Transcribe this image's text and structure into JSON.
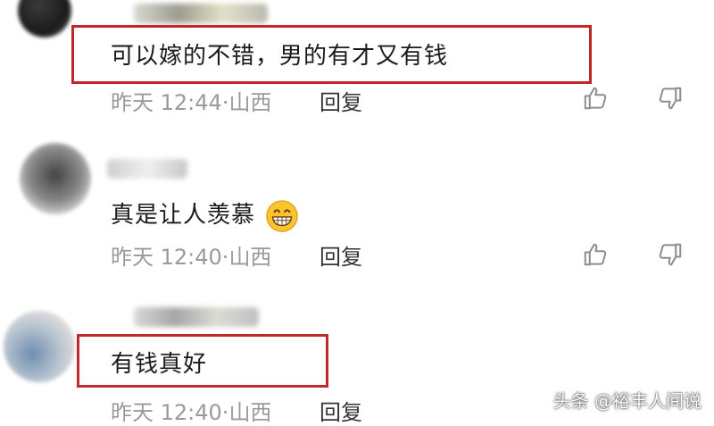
{
  "comments": [
    {
      "text": "可以嫁的不错，男的有才又有钱",
      "time": "昨天 12:44",
      "location": "山西",
      "reply_label": "回复"
    },
    {
      "text": "真是让人羡慕",
      "emoji": "grinning-face",
      "time": "昨天 12:40",
      "location": "山西",
      "reply_label": "回复"
    },
    {
      "text": "有钱真好",
      "time": "昨天 12:40",
      "location": "山西",
      "reply_label": "回复"
    }
  ],
  "meta_separator": "·",
  "watermark": "头条 @裕丰人间说",
  "colors": {
    "highlight_border": "#c0282c",
    "meta_text": "#9a9a9a",
    "icon_stroke": "#8c8c8c"
  },
  "icons": [
    "thumbs-up-icon",
    "thumbs-down-icon"
  ]
}
